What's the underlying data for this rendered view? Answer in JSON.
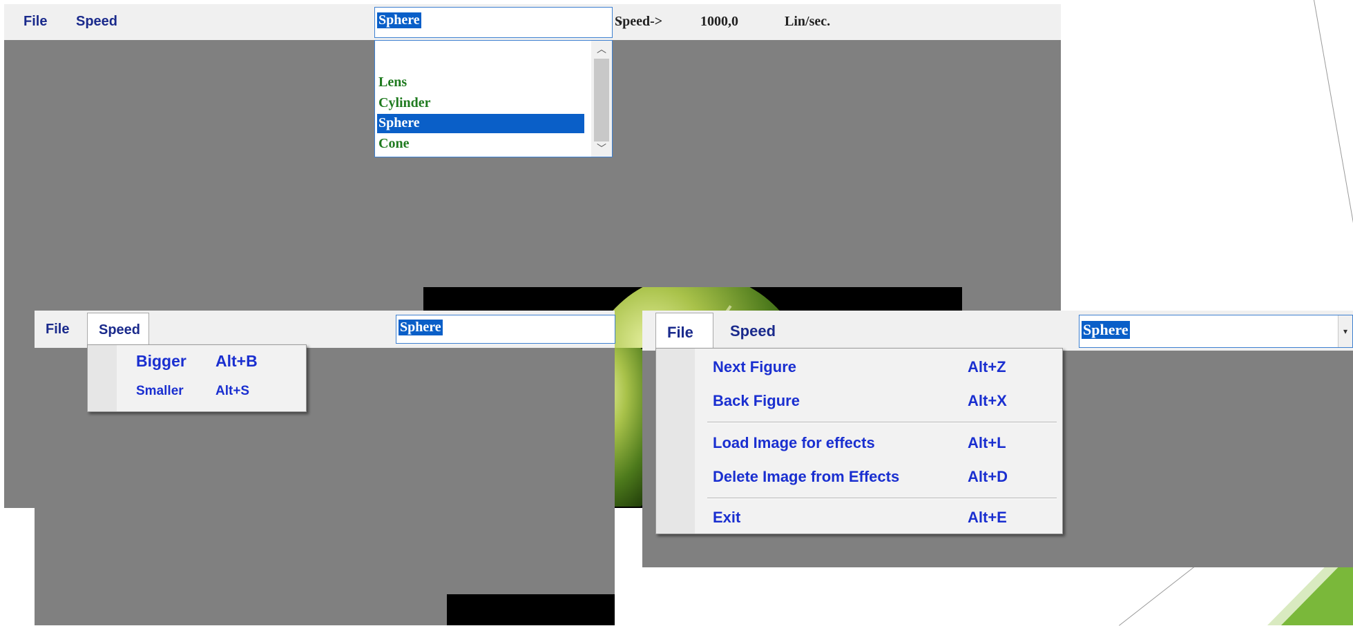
{
  "top_window": {
    "menu": {
      "file": "File",
      "speed": "Speed"
    },
    "combo": {
      "selected": "Sphere"
    },
    "speed_label": "Speed->",
    "speed_value": "1000,0",
    "speed_unit": "Lin/sec.",
    "dropdown_options": [
      "Lens",
      "Cylinder",
      "Sphere",
      "Cone"
    ],
    "dropdown_selected_index": 2
  },
  "left_window": {
    "menu": {
      "file": "File",
      "speed": "Speed"
    },
    "combo": {
      "selected": "Sphere"
    },
    "speed_menu": [
      {
        "label": "Bigger",
        "shortcut": "Alt+B"
      },
      {
        "label": "Smaller",
        "shortcut": "Alt+S"
      }
    ]
  },
  "right_window": {
    "menu": {
      "file": "File",
      "speed": "Speed"
    },
    "combo": {
      "selected": "Sphere"
    },
    "file_menu": [
      {
        "label": "Next Figure",
        "shortcut": "Alt+Z"
      },
      {
        "label": "Back Figure",
        "shortcut": "Alt+X"
      },
      {
        "label": "Load Image for effects",
        "shortcut": "Alt+L"
      },
      {
        "label": "Delete Image from Effects",
        "shortcut": "Alt+D"
      },
      {
        "label": "Exit",
        "shortcut": "Alt+E"
      }
    ]
  },
  "colors": {
    "menu_text": "#1a2a8c",
    "menu_item_text": "#1a2fd0",
    "option_text": "#1f7a1f",
    "selection": "#0a5fc8",
    "canvas": "#808080",
    "accent_green": "#7ab83a"
  },
  "icons": {
    "combo_arrow": "dropdown-arrow-icon",
    "scroll_up": "scroll-up-icon",
    "scroll_down": "scroll-down-icon"
  }
}
